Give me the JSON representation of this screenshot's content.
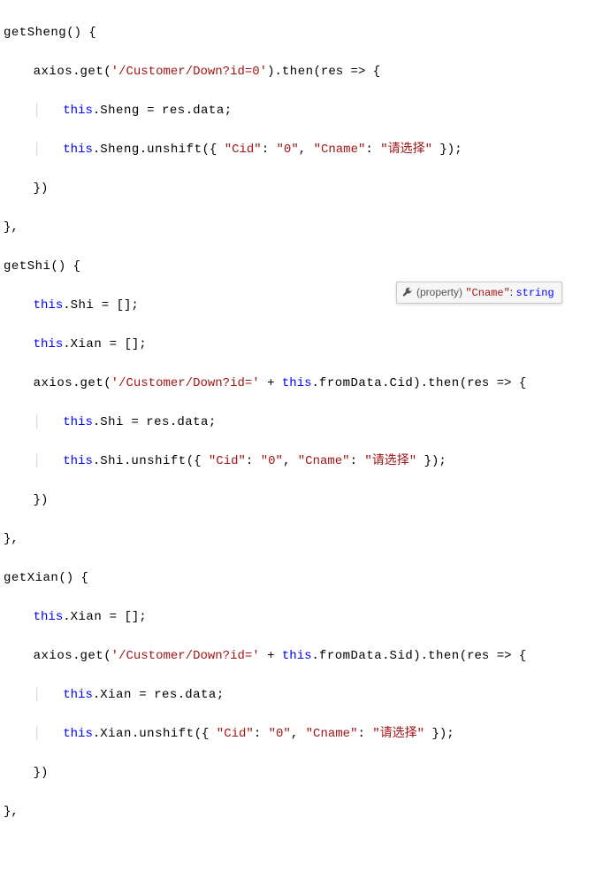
{
  "code": {
    "fn1": "getSheng",
    "fn2": "getShi",
    "fn3": "getXian",
    "axios": "axios",
    "get": "get",
    "then": "then",
    "res": "res",
    "arrow": " => ",
    "this": "this",
    "data": "data",
    "unshift": "unshift",
    "fromData": "fromData",
    "Cid": "Cid",
    "Sid": "Sid",
    "Sheng": "Sheng",
    "Shi": "Shi",
    "Xian": "Xian",
    "url_down0": "'/Customer/Down?id=0'",
    "url_down": "'/Customer/Down?id='",
    "key_Cid": "\"Cid\"",
    "val_0": "\"0\"",
    "key_Cname": "\"Cname\"",
    "val_select": "\"请选择\"",
    "space": " ",
    "empty_arr": "[]"
  },
  "tooltip": {
    "label": "(property)",
    "name": "\"Cname\"",
    "type": "string"
  }
}
